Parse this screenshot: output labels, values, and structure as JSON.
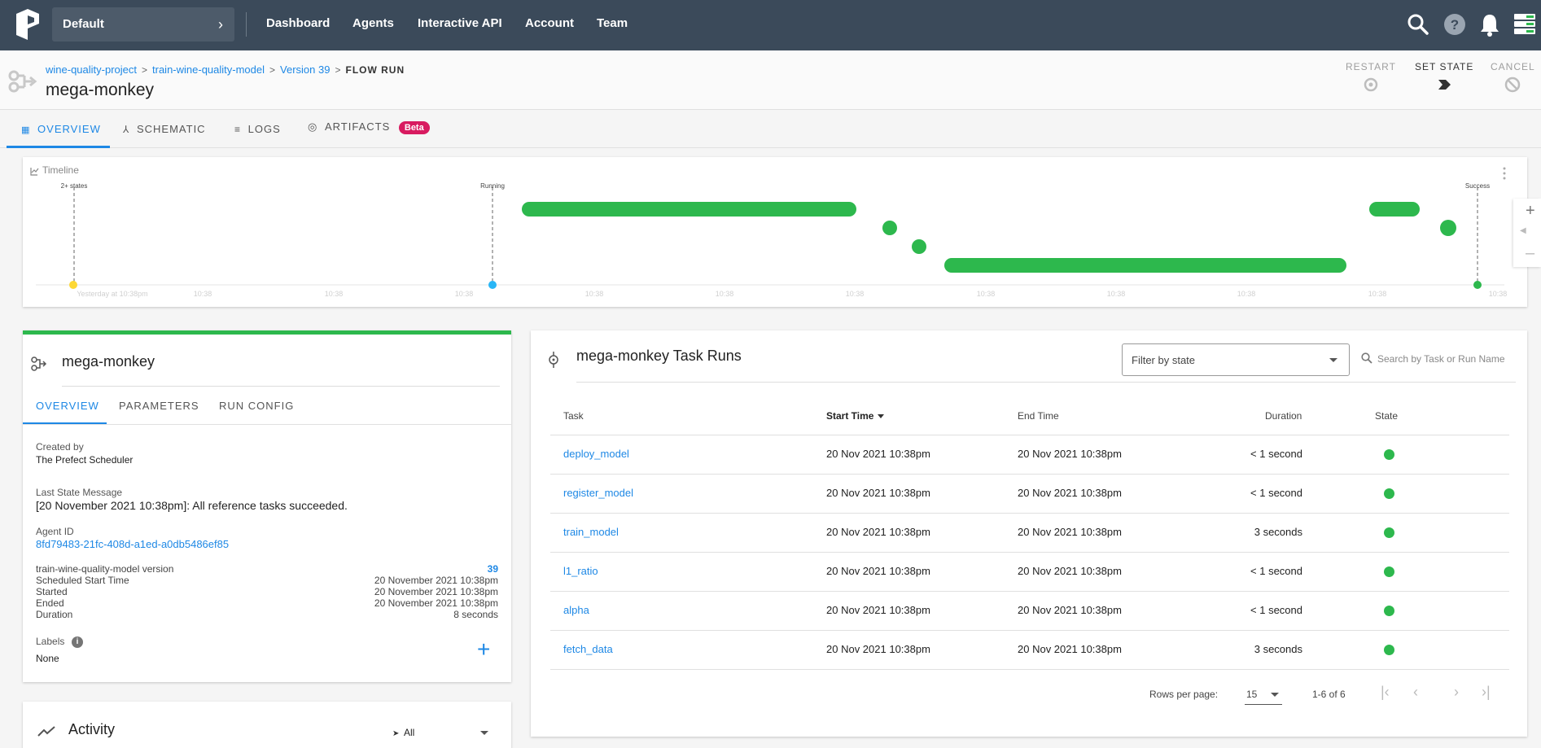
{
  "topbar": {
    "project": "Default",
    "nav": [
      "Dashboard",
      "Agents",
      "Interactive API",
      "Account",
      "Team"
    ]
  },
  "breadcrumb": [
    "wine-quality-project",
    "train-wine-quality-model",
    "Version 39",
    "FLOW RUN"
  ],
  "page_title": "mega-monkey",
  "actions": {
    "restart": "RESTART",
    "set_state": "SET STATE",
    "cancel": "CANCEL"
  },
  "tabs": {
    "overview": "OVERVIEW",
    "schematic": "SCHEMATIC",
    "logs": "LOGS",
    "artifacts": "ARTIFACTS",
    "beta": "Beta"
  },
  "timeline": {
    "title": "Timeline",
    "markers": [
      "2+ states",
      "Running",
      "Success"
    ],
    "axis_labels": [
      "Yesterday at 10:38pm",
      "10:38",
      "10:38",
      "10:38",
      "10:38",
      "10:38",
      "10:38",
      "10:38",
      "10:38",
      "10:38",
      "10:38",
      "10:38"
    ],
    "colors": {
      "success": "#2db84d",
      "running": "#29b6f6",
      "scheduled": "#fdd835"
    }
  },
  "run_card": {
    "title": "mega-monkey",
    "tabs": [
      "OVERVIEW",
      "PARAMETERS",
      "RUN CONFIG"
    ],
    "created_by_label": "Created by",
    "created_by": "The Prefect Scheduler",
    "last_state_label": "Last State Message",
    "last_state": "[20 November 2021 10:38pm]: All reference tasks succeeded.",
    "agent_id_label": "Agent ID",
    "agent_id": "8fd79483-21fc-408d-a1ed-a0db5486ef85",
    "details": [
      {
        "k": "train-wine-quality-model version",
        "v": "39"
      },
      {
        "k": "Scheduled Start Time",
        "v": "20 November 2021 10:38pm"
      },
      {
        "k": "Started",
        "v": "20 November 2021 10:38pm"
      },
      {
        "k": "Ended",
        "v": "20 November 2021 10:38pm"
      },
      {
        "k": "Duration",
        "v": "8 seconds"
      }
    ],
    "labels_label": "Labels",
    "labels_value": "None"
  },
  "activity": {
    "title": "Activity",
    "filter": "All"
  },
  "tasks": {
    "title": "mega-monkey Task Runs",
    "filter_placeholder": "Filter by state",
    "search_placeholder": "Search by Task or Run Name",
    "columns": [
      "Task",
      "Start Time",
      "End Time",
      "Duration",
      "State"
    ],
    "rows": [
      {
        "task": "deploy_model",
        "start": "20 Nov 2021 10:38pm",
        "end": "20 Nov 2021 10:38pm",
        "duration": "< 1 second"
      },
      {
        "task": "register_model",
        "start": "20 Nov 2021 10:38pm",
        "end": "20 Nov 2021 10:38pm",
        "duration": "< 1 second"
      },
      {
        "task": "train_model",
        "start": "20 Nov 2021 10:38pm",
        "end": "20 Nov 2021 10:38pm",
        "duration": "3 seconds"
      },
      {
        "task": "l1_ratio",
        "start": "20 Nov 2021 10:38pm",
        "end": "20 Nov 2021 10:38pm",
        "duration": "< 1 second"
      },
      {
        "task": "alpha",
        "start": "20 Nov 2021 10:38pm",
        "end": "20 Nov 2021 10:38pm",
        "duration": "< 1 second"
      },
      {
        "task": "fetch_data",
        "start": "20 Nov 2021 10:38pm",
        "end": "20 Nov 2021 10:38pm",
        "duration": "3 seconds"
      }
    ],
    "rows_per_page_label": "Rows per page:",
    "rows_per_page": "15",
    "range": "1-6 of 6"
  }
}
